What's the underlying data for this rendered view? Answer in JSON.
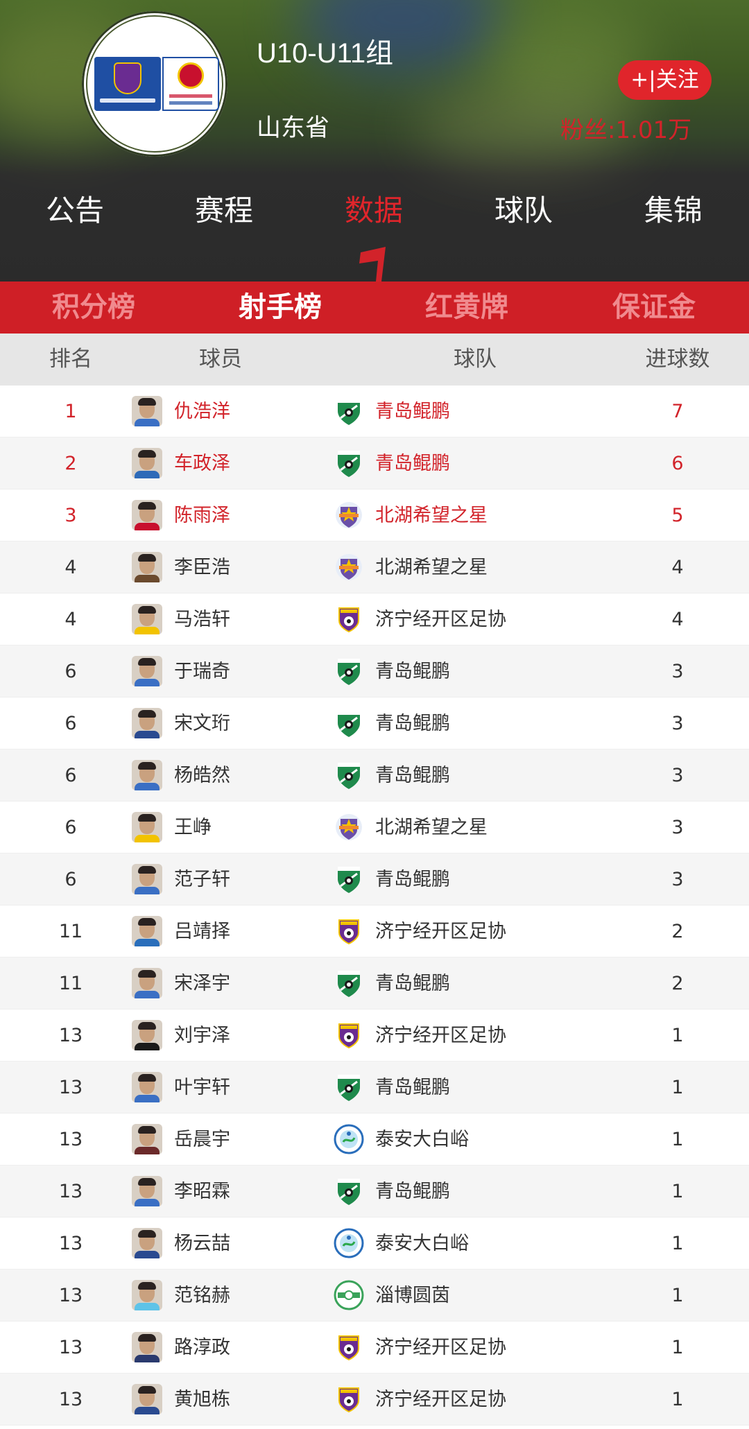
{
  "header": {
    "league_title": "U10-U11组",
    "province": "山东省",
    "follow_label": "+|关注",
    "fans_text": "粉丝:1.01万"
  },
  "main_nav": [
    {
      "label": "公告",
      "active": false
    },
    {
      "label": "赛程",
      "active": false
    },
    {
      "label": "数据",
      "active": true
    },
    {
      "label": "球队",
      "active": false
    },
    {
      "label": "集锦",
      "active": false
    }
  ],
  "sub_tabs": [
    {
      "label": "积分榜",
      "active": false
    },
    {
      "label": "射手榜",
      "active": true
    },
    {
      "label": "红黄牌",
      "active": false
    },
    {
      "label": "保证金",
      "active": false
    }
  ],
  "table": {
    "headers": {
      "rank": "排名",
      "player": "球员",
      "team": "球队",
      "goals": "进球数"
    },
    "rows": [
      {
        "rank": "1",
        "player": "仇浩洋",
        "team": "青岛鲲鹏",
        "team_logo": "green-shield-logo",
        "goals": "7"
      },
      {
        "rank": "2",
        "player": "车政泽",
        "team": "青岛鲲鹏",
        "team_logo": "green-shield-logo",
        "goals": "6"
      },
      {
        "rank": "3",
        "player": "陈雨泽",
        "team": "北湖希望之星",
        "team_logo": "star-crest-logo",
        "goals": "5"
      },
      {
        "rank": "4",
        "player": "李臣浩",
        "team": "北湖希望之星",
        "team_logo": "star-crest-logo",
        "goals": "4"
      },
      {
        "rank": "4",
        "player": "马浩轩",
        "team": "济宁经开区足协",
        "team_logo": "purple-shield-logo",
        "goals": "4"
      },
      {
        "rank": "6",
        "player": "于瑞奇",
        "team": "青岛鲲鹏",
        "team_logo": "green-shield-logo",
        "goals": "3"
      },
      {
        "rank": "6",
        "player": "宋文珩",
        "team": "青岛鲲鹏",
        "team_logo": "green-shield-logo",
        "goals": "3"
      },
      {
        "rank": "6",
        "player": "杨皓然",
        "team": "青岛鲲鹏",
        "team_logo": "green-shield-logo",
        "goals": "3"
      },
      {
        "rank": "6",
        "player": "王峥",
        "team": "北湖希望之星",
        "team_logo": "star-crest-logo",
        "goals": "3"
      },
      {
        "rank": "6",
        "player": "范子轩",
        "team": "青岛鲲鹏",
        "team_logo": "green-shield-logo",
        "goals": "3"
      },
      {
        "rank": "11",
        "player": "吕靖择",
        "team": "济宁经开区足协",
        "team_logo": "purple-shield-logo",
        "goals": "2"
      },
      {
        "rank": "11",
        "player": "宋泽宇",
        "team": "青岛鲲鹏",
        "team_logo": "green-shield-logo",
        "goals": "2"
      },
      {
        "rank": "13",
        "player": "刘宇泽",
        "team": "济宁经开区足协",
        "team_logo": "purple-shield-logo",
        "goals": "1"
      },
      {
        "rank": "13",
        "player": "叶宇轩",
        "team": "青岛鲲鹏",
        "team_logo": "green-shield-logo",
        "goals": "1"
      },
      {
        "rank": "13",
        "player": "岳晨宇",
        "team": "泰安大白峪",
        "team_logo": "blue-circle-logo",
        "goals": "1"
      },
      {
        "rank": "13",
        "player": "李昭霖",
        "team": "青岛鲲鹏",
        "team_logo": "green-shield-logo",
        "goals": "1"
      },
      {
        "rank": "13",
        "player": "杨云喆",
        "team": "泰安大白峪",
        "team_logo": "blue-circle-logo",
        "goals": "1"
      },
      {
        "rank": "13",
        "player": "范铭赫",
        "team": "淄博圆茵",
        "team_logo": "green-ring-logo",
        "goals": "1"
      },
      {
        "rank": "13",
        "player": "路淳政",
        "team": "济宁经开区足协",
        "team_logo": "purple-shield-logo",
        "goals": "1"
      },
      {
        "rank": "13",
        "player": "黄旭栋",
        "team": "济宁经开区足协",
        "team_logo": "purple-shield-logo",
        "goals": "1"
      }
    ]
  },
  "colors": {
    "accent_red": "#cf1f26",
    "highlight_red": "#d2232a",
    "inactive_tab_text": "#f08a8e"
  }
}
